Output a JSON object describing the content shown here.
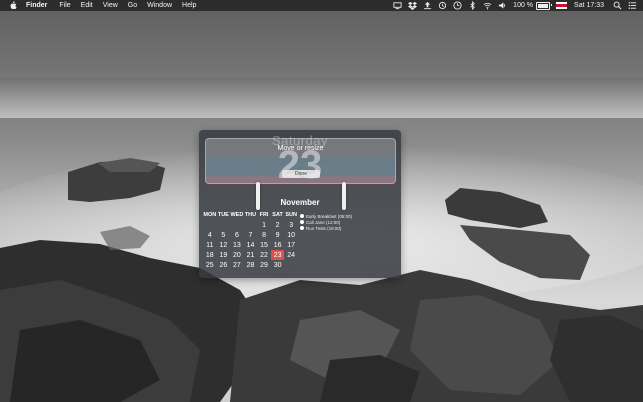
{
  "menubar": {
    "app_name": "Finder",
    "menus": [
      "File",
      "Edit",
      "View",
      "Go",
      "Window",
      "Help"
    ],
    "status_icons": [
      "screen-icon",
      "dropbox-icon",
      "upload-icon",
      "sync-icon",
      "time-machine-icon",
      "bluetooth-icon",
      "wifi-icon",
      "volume-icon"
    ],
    "battery_text": "100 %",
    "battery_level": 1.0,
    "clock": "Sat 17:33",
    "right_icons": [
      "spotlight-icon",
      "notification-center-icon"
    ]
  },
  "widget": {
    "day_name": "Saturday",
    "day_number": "23",
    "resize_message": "Move or resize",
    "done_label": "Done",
    "month": "November",
    "weekdays": [
      "MON",
      "TUE",
      "WED",
      "THU",
      "FRI",
      "SAT",
      "SUN"
    ],
    "weeks": [
      [
        "",
        "",
        "",
        "",
        "1",
        "2",
        "3"
      ],
      [
        "4",
        "5",
        "6",
        "7",
        "8",
        "9",
        "10"
      ],
      [
        "11",
        "12",
        "13",
        "14",
        "15",
        "16",
        "17"
      ],
      [
        "18",
        "19",
        "20",
        "21",
        "22",
        "23",
        "24"
      ],
      [
        "25",
        "26",
        "27",
        "28",
        "29",
        "30",
        ""
      ]
    ],
    "today": "23",
    "events": [
      "Early Breakfast (05:00)",
      "Call Jane (12:00)",
      "Run Tests (18:00)"
    ]
  }
}
